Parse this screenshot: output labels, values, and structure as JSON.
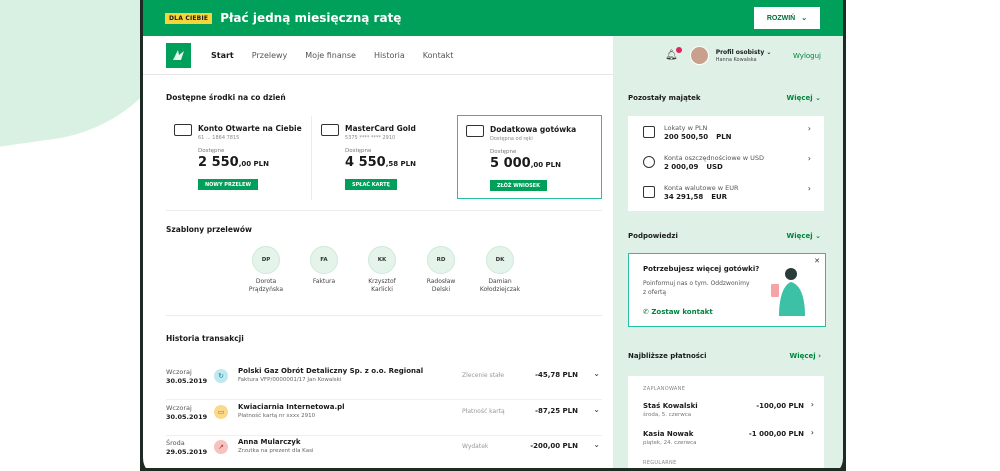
{
  "promo": {
    "badge": "DLA CIEBIE",
    "title": "Płać jedną miesięczną ratę",
    "button": "ROZWIŃ"
  },
  "nav": {
    "items": [
      "Start",
      "Przelewy",
      "Moje finanse",
      "Historia",
      "Kontakt"
    ]
  },
  "profile": {
    "title": "Profil osobisty",
    "name": "Hanna Kowalska",
    "logout": "Wyloguj",
    "notifications": "3"
  },
  "funds": {
    "title": "Dostępne środki na co dzień",
    "accounts": [
      {
        "name": "Konto Otwarte na Ciebie",
        "number": "61 ... 1864 7815",
        "label": "Dostępne",
        "amount_main": "2 550",
        "amount_dec": ",00 PLN",
        "button": "NOWY PRZELEW"
      },
      {
        "name": "MasterCard Gold",
        "number": "5375 **** **** 2910",
        "label": "Dostępne",
        "amount_main": "4 550",
        "amount_dec": ",58 PLN",
        "button": "SPŁAĆ KARTĘ"
      },
      {
        "name": "Dodatkowa gotówka",
        "number": "Dostępna od ręki",
        "label": "Dostępne",
        "amount_main": "5 000",
        "amount_dec": ",00 PLN",
        "button": "ZŁÓŻ WNIOSEK"
      }
    ]
  },
  "templates": {
    "title": "Szablony przelewów",
    "items": [
      {
        "initials": "DP",
        "name1": "Dorota",
        "name2": "Prądzyńska"
      },
      {
        "initials": "FA",
        "name1": "Faktura",
        "name2": ""
      },
      {
        "initials": "KK",
        "name1": "Krzysztof",
        "name2": "Karlicki"
      },
      {
        "initials": "RD",
        "name1": "Radosław",
        "name2": "Delski"
      },
      {
        "initials": "DK",
        "name1": "Damian",
        "name2": "Kołodziejczak"
      }
    ]
  },
  "history": {
    "title": "Historia transakcji",
    "rows": [
      {
        "day": "Wczoraj",
        "date": "30.05.2019",
        "title": "Polski Gaz Obrót Detaliczny Sp. z o.o. Regional",
        "sub": "Faktura VFP/0000001/17 Jan Kowalski",
        "type": "Zlecenie stałe",
        "amount": "-45,78 PLN"
      },
      {
        "day": "Wczoraj",
        "date": "30.05.2019",
        "title": "Kwiaciarnia Internetowa.pl",
        "sub": "Płatność kartą nr xxxx 2910",
        "type": "Płatność kartą",
        "amount": "-87,25 PLN"
      },
      {
        "day": "Środa",
        "date": "29.05.2019",
        "title": "Anna Mularczyk",
        "sub": "Zrzutka na prezent dla Kasi",
        "type": "Wydatek",
        "amount": "-200,00 PLN"
      }
    ]
  },
  "assets": {
    "title": "Pozostały majątek",
    "more": "Więcej",
    "items": [
      {
        "label": "Lokaty w PLN",
        "value": "200 500,50",
        "currency": "PLN"
      },
      {
        "label": "Konta oszczędnościowe w USD",
        "value": "2 000,09",
        "currency": "USD"
      },
      {
        "label": "Konta walutowe w EUR",
        "value": "34 291,58",
        "currency": "EUR"
      }
    ]
  },
  "hints": {
    "title": "Podpowiedzi",
    "more": "Więcej",
    "card_title": "Potrzebujesz więcej gotówki?",
    "card_text": "Poinformuj nas o tym. Oddzwonimy z ofertą",
    "card_link": "Zostaw kontakt"
  },
  "payments": {
    "title": "Najbliższe płatności",
    "more": "Więcej",
    "category1": "ZAPLANOWANE",
    "category2": "REGULARNE",
    "items": [
      {
        "name": "Staś Kowalski",
        "sub": "środa, 5. czerwca",
        "amount": "-100,00 PLN"
      },
      {
        "name": "Kasia Nowak",
        "sub": "piątek, 24. czerwca",
        "amount": "-1 000,00 PLN"
      }
    ]
  },
  "colors": {
    "brand_green": "#00a05a",
    "accent_teal": "#27bfa4",
    "side_bg": "#dff1e6"
  }
}
